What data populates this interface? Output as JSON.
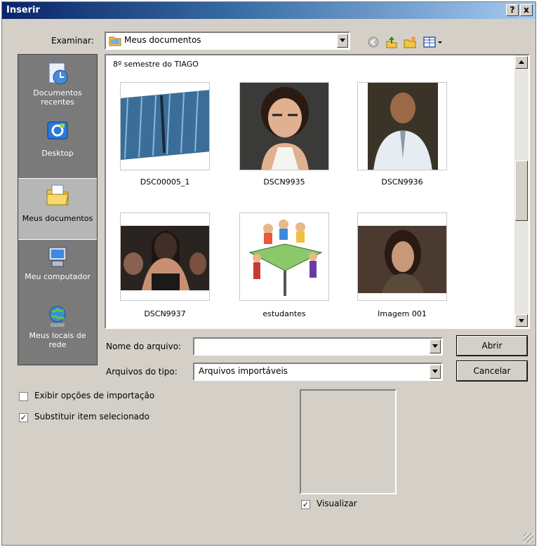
{
  "window": {
    "title": "Inserir",
    "help_label": "?",
    "close_label": "x"
  },
  "lookin": {
    "label": "Examinar:",
    "value": "Meus documentos"
  },
  "places": [
    {
      "label": "Documentos recentes",
      "icon": "recent-documents-icon"
    },
    {
      "label": "Desktop",
      "icon": "desktop-icon"
    },
    {
      "label": "Meus documentos",
      "icon": "my-documents-folder-icon"
    },
    {
      "label": "Meu computador",
      "icon": "my-computer-icon"
    },
    {
      "label": "Meus locais de rede",
      "icon": "network-places-icon"
    }
  ],
  "filelist": {
    "folder": "8º semestre do TIAGO",
    "files": [
      "DSC00005_1",
      "DSCN9935",
      "DSCN9936",
      "DSCN9937",
      "estudantes",
      "Imagem 001"
    ]
  },
  "filename": {
    "label": "Nome do arquivo:",
    "value": ""
  },
  "filetype": {
    "label": "Arquivos do tipo:",
    "value": "Arquivos importáveis"
  },
  "buttons": {
    "open": "Abrir",
    "cancel": "Cancelar"
  },
  "options": {
    "import_options": {
      "label": "Exibir opções de importação",
      "checked": false
    },
    "replace": {
      "label": "Substituir item selecionado",
      "checked": true
    },
    "preview": {
      "label": "Visualizar",
      "checked": true
    }
  },
  "colors": {
    "titlebar_start": "#0a246a",
    "titlebar_end": "#a6caf0",
    "dialog_bg": "#d4d0c8"
  }
}
